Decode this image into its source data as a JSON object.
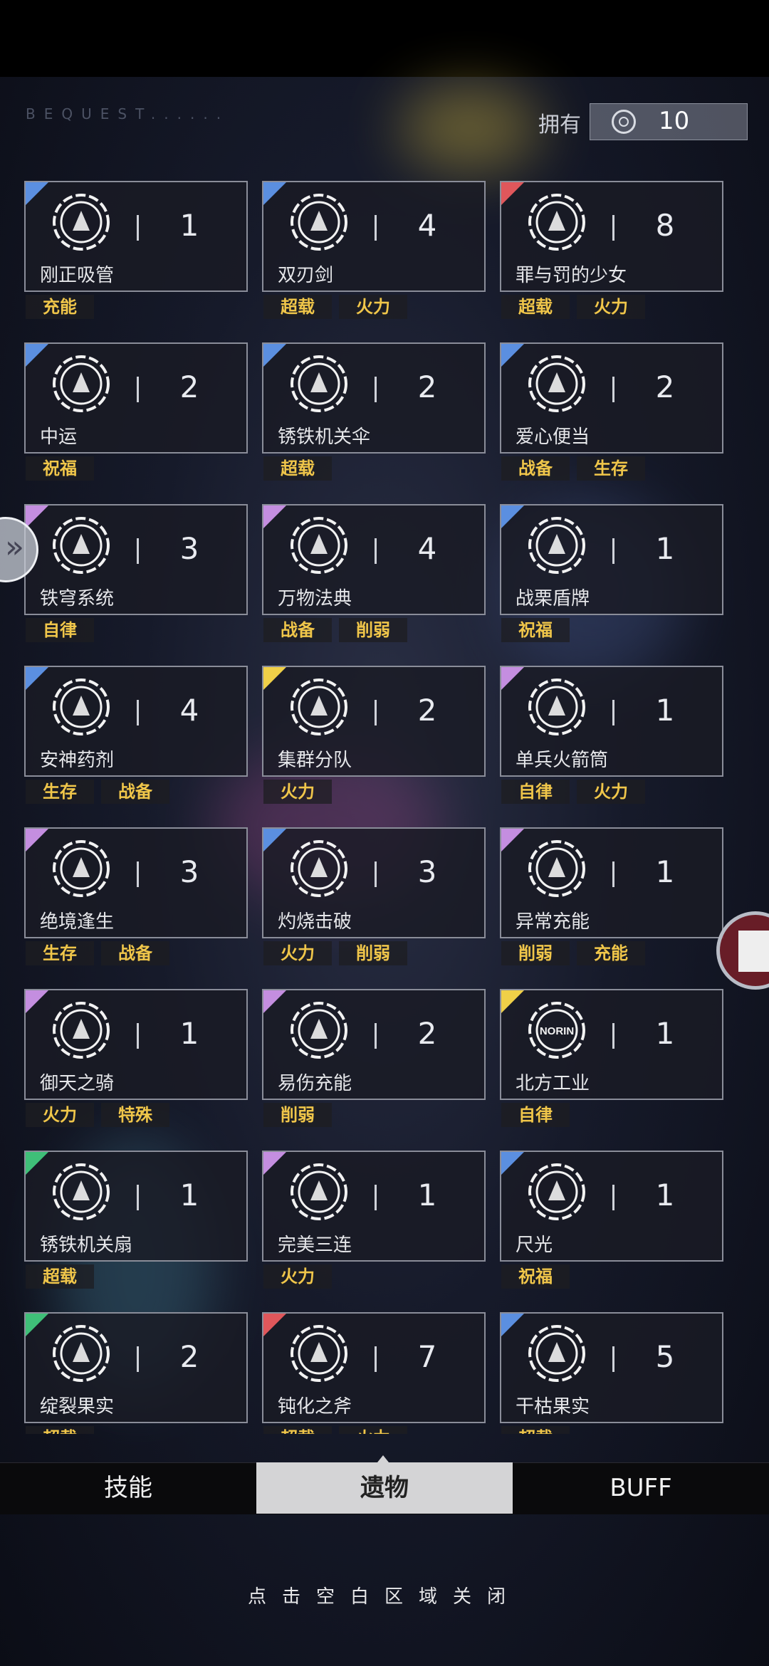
{
  "header": {
    "bequest_text": "BEQUEST......",
    "own_label": "拥有",
    "own_count": "10"
  },
  "relics": [
    {
      "name": "刚正吸管",
      "count": "1",
      "rarity_color": "#5b8fe0",
      "icon": "straw-icon",
      "tags": [
        "充能"
      ]
    },
    {
      "name": "双刃剑",
      "count": "4",
      "rarity_color": "#5b8fe0",
      "icon": "double-blade-icon",
      "tags": [
        "超载",
        "火力"
      ]
    },
    {
      "name": "罪与罚的少女",
      "count": "8",
      "rarity_color": "#e0575b",
      "icon": "girl-icon",
      "tags": [
        "超载",
        "火力"
      ]
    },
    {
      "name": "中运",
      "count": "2",
      "rarity_color": "#5b8fe0",
      "icon": "star-icon",
      "tags": [
        "祝福"
      ]
    },
    {
      "name": "锈铁机关伞",
      "count": "2",
      "rarity_color": "#5b8fe0",
      "icon": "umbrella-icon",
      "tags": [
        "超载"
      ]
    },
    {
      "name": "爱心便当",
      "count": "2",
      "rarity_color": "#5b8fe0",
      "icon": "lunchbox-icon",
      "tags": [
        "战备",
        "生存"
      ]
    },
    {
      "name": "铁穹系统",
      "count": "3",
      "rarity_color": "#c48ee0",
      "icon": "target-icon",
      "tags": [
        "自律"
      ]
    },
    {
      "name": "万物法典",
      "count": "4",
      "rarity_color": "#c48ee0",
      "icon": "book-icon",
      "tags": [
        "战备",
        "削弱"
      ]
    },
    {
      "name": "战栗盾牌",
      "count": "1",
      "rarity_color": "#5b8fe0",
      "icon": "shield-icon",
      "tags": [
        "祝福"
      ]
    },
    {
      "name": "安神药剂",
      "count": "4",
      "rarity_color": "#5b8fe0",
      "icon": "potion-icon",
      "tags": [
        "生存",
        "战备"
      ]
    },
    {
      "name": "集群分队",
      "count": "2",
      "rarity_color": "#f0d048",
      "icon": "squad-icon",
      "tags": [
        "火力"
      ]
    },
    {
      "name": "单兵火箭筒",
      "count": "1",
      "rarity_color": "#c48ee0",
      "icon": "rocket-launcher-icon",
      "tags": [
        "自律",
        "火力"
      ]
    },
    {
      "name": "绝境逢生",
      "count": "3",
      "rarity_color": "#c48ee0",
      "icon": "revive-icon",
      "tags": [
        "生存",
        "战备"
      ]
    },
    {
      "name": "灼烧击破",
      "count": "3",
      "rarity_color": "#5b8fe0",
      "icon": "flame-icon",
      "tags": [
        "火力",
        "削弱"
      ]
    },
    {
      "name": "异常充能",
      "count": "1",
      "rarity_color": "#c48ee0",
      "icon": "charge-icon",
      "tags": [
        "削弱",
        "充能"
      ]
    },
    {
      "name": "御天之骑",
      "count": "1",
      "rarity_color": "#c48ee0",
      "icon": "clock-icon",
      "tags": [
        "火力",
        "特殊"
      ]
    },
    {
      "name": "易伤充能",
      "count": "2",
      "rarity_color": "#c48ee0",
      "icon": "cracked-shield-icon",
      "tags": [
        "削弱"
      ]
    },
    {
      "name": "北方工业",
      "count": "1",
      "rarity_color": "#f0d048",
      "icon": "norin-logo-icon",
      "icon_text": "NORIN",
      "tags": [
        "自律"
      ]
    },
    {
      "name": "锈铁机关扇",
      "count": "1",
      "rarity_color": "#3fbf78",
      "icon": "fan-icon",
      "tags": [
        "超载"
      ]
    },
    {
      "name": "完美三连",
      "count": "1",
      "rarity_color": "#c48ee0",
      "icon": "swirl-icon",
      "tags": [
        "火力"
      ]
    },
    {
      "name": "尺光",
      "count": "1",
      "rarity_color": "#5b8fe0",
      "icon": "tri-blade-icon",
      "tags": [
        "祝福"
      ]
    },
    {
      "name": "绽裂果实",
      "count": "2",
      "rarity_color": "#3fbf78",
      "icon": "fruit-icon",
      "tags": [
        "超载"
      ]
    },
    {
      "name": "钝化之斧",
      "count": "7",
      "rarity_color": "#e0575b",
      "icon": "axe-icon",
      "tags": [
        "超载",
        "火力"
      ]
    },
    {
      "name": "干枯果实",
      "count": "5",
      "rarity_color": "#5b8fe0",
      "icon": "withered-fruit-icon",
      "tags": [
        "超载"
      ]
    }
  ],
  "tabs": [
    {
      "label": "技能",
      "active": false
    },
    {
      "label": "遗物",
      "active": true
    },
    {
      "label": "BUFF",
      "active": false
    }
  ],
  "hint": "点击空白区域关闭"
}
